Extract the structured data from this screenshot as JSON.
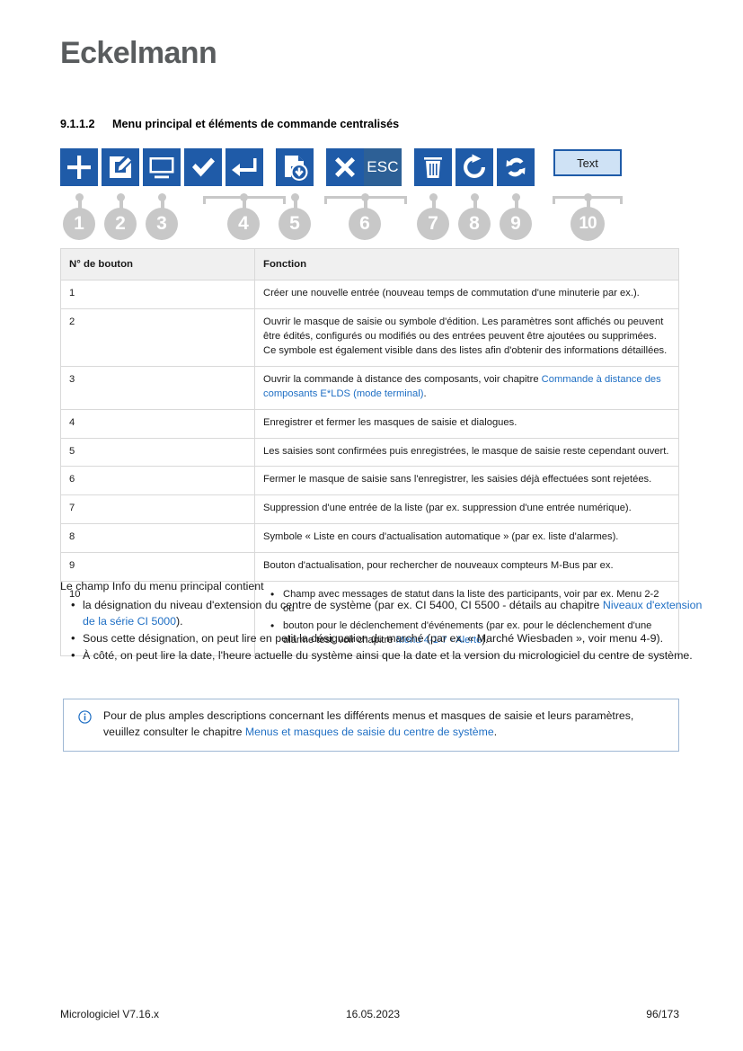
{
  "brand": {
    "logo": "Eckelmann"
  },
  "heading": {
    "number": "9.1.1.2",
    "title": "Menu principal et éléments de commande centralisés"
  },
  "icons": [
    {
      "name": "plus-icon",
      "label": "+"
    },
    {
      "name": "edit-pencil-icon",
      "label": ""
    },
    {
      "name": "monitor-icon",
      "label": ""
    },
    {
      "name": "check-icon",
      "label": ""
    },
    {
      "name": "enter-return-icon",
      "label": ""
    },
    {
      "name": "document-download-icon",
      "label": ""
    },
    {
      "name": "close-x-icon",
      "label": ""
    },
    {
      "name": "esc-icon",
      "label": "ESC"
    },
    {
      "name": "trash-icon",
      "label": ""
    },
    {
      "name": "refresh-icon",
      "label": ""
    },
    {
      "name": "sync-icon",
      "label": ""
    },
    {
      "name": "text-button",
      "label": "Text"
    }
  ],
  "callouts": [
    "1",
    "2",
    "3",
    "4",
    "5",
    "6",
    "7",
    "8",
    "9",
    "10"
  ],
  "table": {
    "headers": [
      "N° de bouton",
      "Fonction"
    ],
    "rows": [
      {
        "num": "1",
        "text": "Créer une nouvelle entrée (nouveau temps de commutation d'une minuterie par ex.)."
      },
      {
        "num": "2",
        "text": "Ouvrir le masque de saisie ou symbole d'édition. Les paramètres sont affichés ou peuvent être édités, configurés ou modifiés ou des entrées peuvent être ajoutées ou supprimées. Ce symbole est également visible dans des listes afin d'obtenir des informations détaillées."
      },
      {
        "num": "3",
        "pre": "Ouvrir la commande à distance des composants, voir chapitre ",
        "link": "Commande à distance des composants E*LDS (mode terminal)",
        "post": "."
      },
      {
        "num": "4",
        "text": "Enregistrer et fermer les masques de saisie et dialogues."
      },
      {
        "num": "5",
        "text": "Les saisies sont confirmées puis enregistrées, le masque de saisie reste cependant ouvert."
      },
      {
        "num": "6",
        "text": "Fermer le masque de saisie sans l'enregistrer, les saisies déjà effectuées sont rejetées."
      },
      {
        "num": "7",
        "text": "Suppression d'une entrée de la liste (par ex. suppression d'une entrée numérique)."
      },
      {
        "num": "8",
        "text": "Symbole « Liste en cours d'actualisation automatique » (par ex. liste d'alarmes)."
      },
      {
        "num": "9",
        "text": "Bouton d'actualisation, pour rechercher de nouveaux compteurs M-Bus par ex."
      },
      {
        "num": "10",
        "bullets": [
          {
            "text": "Champ avec messages de statut dans la liste des participants, voir par ex. Menu 2-2 ou"
          },
          {
            "pre": "bouton pour le déclenchement d'événements (par ex. pour le déclenchement d'une alarme test, voir chapitre ",
            "link": "Menu 4-1-7 - Alerte",
            "post": ")."
          }
        ]
      }
    ]
  },
  "body": {
    "intro": "Le champ Info du menu principal contient",
    "bullets": [
      {
        "pre": "la désignation du niveau d'extension du centre de système (par ex. CI 5400, CI 5500 - détails au chapitre ",
        "link": "Niveaux d'extension de la série CI 5000",
        "post": ")."
      },
      {
        "pre": "Sous cette désignation, on peut lire en petit la désignation du marché (par ex. « Marché Wiesbaden », voir menu 4-9).",
        "link": "",
        "post": ""
      },
      {
        "pre": "À côté, on peut lire la date, l'heure actuelle du système ainsi que la date et la version du micrologiciel du centre de système.",
        "link": "",
        "post": ""
      }
    ]
  },
  "infobox": {
    "pre": "Pour de plus amples descriptions concernant les différents menus et masques de saisie et leurs paramètres, veuillez consulter le chapitre ",
    "link": "Menus et masques de saisie du centre de système",
    "post": "."
  },
  "footer": {
    "left": "Micrologiciel V7.16.x",
    "center": "16.05.2023",
    "right": "96/173"
  },
  "colors": {
    "icon_blue": "#1f5ba8",
    "link_blue": "#1f6fc4",
    "callout_gray": "#c8c8c8",
    "logo_gray": "#595c5e",
    "table_header_bg": "#f0f0f0",
    "text_button_bg": "#cfe2f5"
  }
}
